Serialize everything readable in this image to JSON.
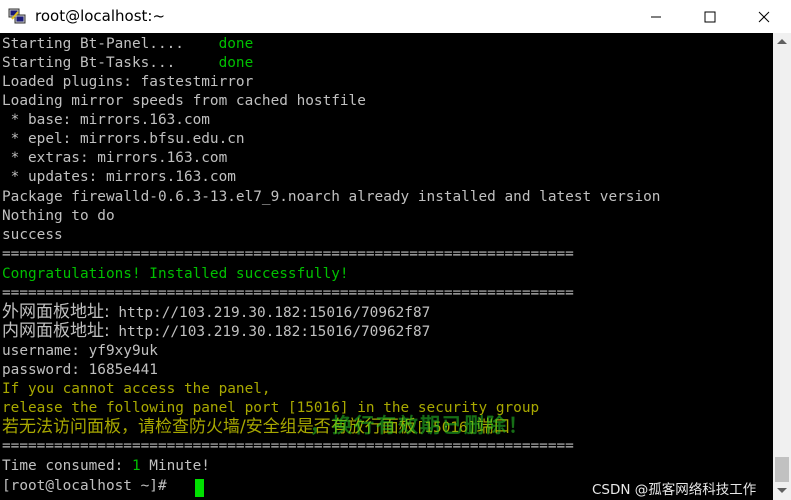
{
  "window": {
    "title": "root@localhost:~"
  },
  "terminal": {
    "lines": [
      {
        "text": "Starting Bt-Panel....",
        "status": "done"
      },
      {
        "text": "Starting Bt-Tasks...",
        "status": "done"
      },
      {
        "text": "Loaded plugins: fastestmirror"
      },
      {
        "text": "Loading mirror speeds from cached hostfile"
      },
      {
        "text": " * base: mirrors.163.com"
      },
      {
        "text": " * epel: mirrors.bfsu.edu.cn"
      },
      {
        "text": " * extras: mirrors.163.com"
      },
      {
        "text": " * updates: mirrors.163.com"
      },
      {
        "text": "Package firewalld-0.6.3-13.el7_9.noarch already installed and latest version"
      },
      {
        "text": "Nothing to do"
      },
      {
        "text": "success"
      },
      {
        "text": "=================================================================="
      },
      {
        "text": "Congratulations! Installed successfully!"
      },
      {
        "text": "=================================================================="
      },
      {
        "label": "外网面板地址:",
        "text": " http://103.219.30.182:15016/70962f87"
      },
      {
        "label": "内网面板地址:",
        "text": " http://103.219.30.182:15016/70962f87"
      },
      {
        "text": "username: yf9xy9uk"
      },
      {
        "text": "password: 1685e441"
      },
      {
        "text": "If you cannot access the panel,"
      },
      {
        "text": "release the following panel port [15016] in the security group"
      },
      {
        "label": "若无法访问面板，请检查防火墙/安全组是否有放行面板",
        "text": "[15016]",
        "suffix": "端口"
      },
      {
        "text": "=================================================================="
      },
      {
        "text": "Time consumed: ",
        "value": "1",
        "suffix": " Minute!"
      },
      {
        "text": "[root@localhost ~]# "
      }
    ],
    "overlay": "，换行有效期已删除！"
  },
  "watermark": "CSDN @孤客网络科技工作"
}
